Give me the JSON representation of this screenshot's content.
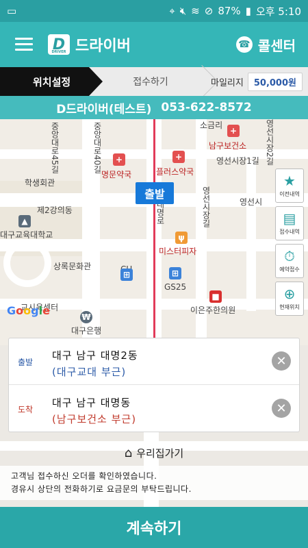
{
  "status_bar": {
    "battery": "87%",
    "time": "오후 5:10"
  },
  "app_bar": {
    "logo_letter": "D",
    "logo_sub": "DRIVER",
    "title": "드라이버",
    "call_center_label": "콜센터"
  },
  "steps": {
    "active": "위치설정",
    "next": "접수하기",
    "mileage_label": "마일리지",
    "mileage_value": "50,000원"
  },
  "driver_info": {
    "name": "D드라이버(테스트)",
    "phone": "053-622-8572"
  },
  "map": {
    "depart_marker": "출발",
    "google": "Google",
    "labels": {
      "sogeumri": "소금리",
      "namgu_health": "남구보건소",
      "yeongseon_1gil": "영선시장1길",
      "myeongmun_pharmacy": "명문약국",
      "plus_pharmacy": "플러스약국",
      "student_hall": "학생회관",
      "dormitory": "제2강의동",
      "daegu_edu_univ": "대구교육대학교",
      "yeongseon": "영선시",
      "mister_pizza": "미스터피자",
      "gyeonggwan": "상록문화관",
      "cu": "CU",
      "gs25": "GS25",
      "clinic": "이은주한의원",
      "center": "교시육센터",
      "daegu_bank": "대구은행",
      "road_45": "중앙대로45길",
      "road_40": "중앙대로40길",
      "road_market": "영선시장길",
      "road_market2": "영선시장2길",
      "road_daeme": "대명로"
    }
  },
  "side_buttons": [
    {
      "label": "이전내역",
      "icon": "star-icon"
    },
    {
      "label": "접수내역",
      "icon": "clipboard-icon"
    },
    {
      "label": "예약접수",
      "icon": "stopwatch-icon"
    },
    {
      "label": "현재위치",
      "icon": "crosshair-icon"
    }
  ],
  "departure": {
    "tag": "출발",
    "address": "대구 남구 대명2동",
    "landmark": "(대구교대 부근)"
  },
  "arrival": {
    "tag": "도착",
    "address": "대구 남구 대명동",
    "landmark": "(남구보건소 부근)"
  },
  "home_link": "우리집가기",
  "notice": {
    "line1": "고객님 접수하신 오더를 확인하였습니다.",
    "line2": "경유시 상단의 전화하기로 요금문의 부탁드립니다."
  },
  "continue_button": "계속하기",
  "colors": {
    "primary": "#35b6b7",
    "status": "#2a9fa2",
    "marker": "#1779d9"
  }
}
